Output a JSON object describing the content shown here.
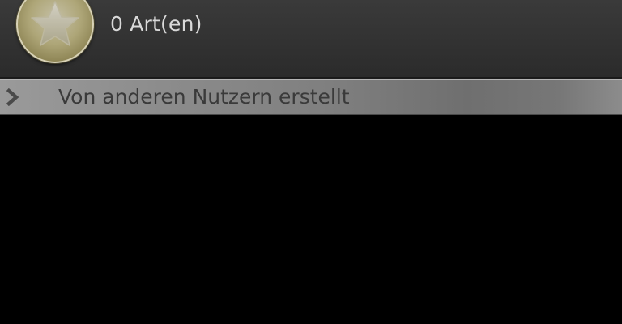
{
  "item": {
    "count_label": "0 Art(en)",
    "icon": "star-icon"
  },
  "section": {
    "label": "Von anderen Nutzern erstellt",
    "icon": "chevron-right-icon"
  },
  "colors": {
    "background": "#000000",
    "row_background": "#333333",
    "header_gradient_start": "#9a9a9a",
    "badge_gold": "#aea678"
  }
}
